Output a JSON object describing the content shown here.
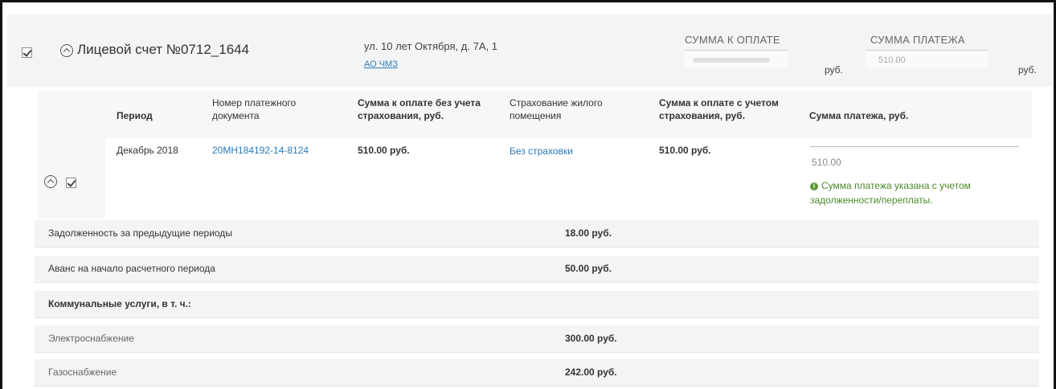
{
  "account": {
    "title": "Лицевой счет №0712_1644",
    "address": "ул. 10 лет Октября, д. 7А, 1",
    "org": "АО ЧМЗ",
    "sum_due_label": "СУММА К ОПЛАТЕ",
    "sum_payment_label": "СУММА ПЛАТЕЖА",
    "currency": "руб.",
    "payment_value": "510.00"
  },
  "table": {
    "headers": [
      "Период",
      "Номер платежного документа",
      "Сумма к оплате без учета страхования, руб.",
      "Страхование жилого помещения",
      "Сумма к оплате с учетом страхования, руб.",
      "Сумма платежа, руб."
    ],
    "row": {
      "period": "Декабрь 2018",
      "doc_number": "20МН184192-14-8124",
      "sum_no_ins": "510.00 руб.",
      "insurance": "Без страховки",
      "sum_with_ins": "510.00 руб.",
      "payment": "510.00",
      "note": "Сумма платежа указана с учетом задолженности/переплаты."
    }
  },
  "summary": [
    {
      "label": "Задолженность за предыдущие периоды",
      "value": "18.00 руб."
    },
    {
      "label": "Аванс на начало расчетного периода",
      "value": "50.00 руб."
    },
    {
      "label": "Коммунальные услуги, в т. ч.:",
      "value": ""
    },
    {
      "label": "Электроснабжение",
      "value": "300.00 руб."
    },
    {
      "label": "Газоснабжение",
      "value": "242.00 руб."
    }
  ]
}
